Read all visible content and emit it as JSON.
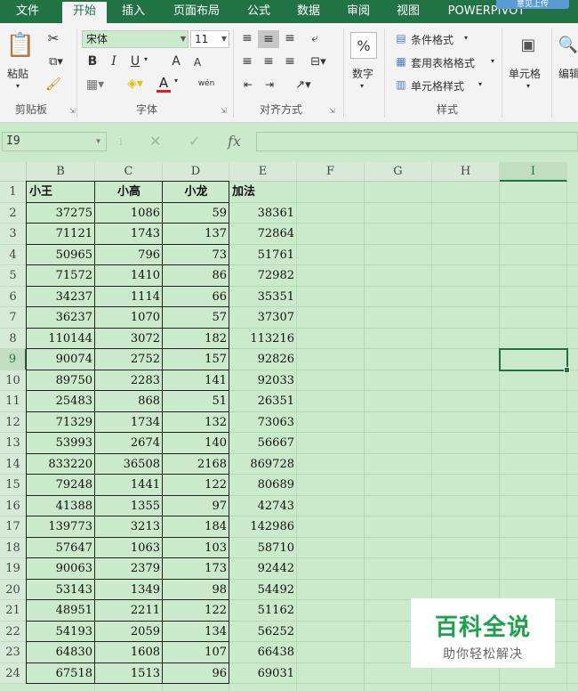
{
  "ribbon": {
    "tabs": [
      "文件",
      "开始",
      "插入",
      "页面布局",
      "公式",
      "数据",
      "审阅",
      "视图",
      "POWERPIVOT"
    ],
    "active_tab": "开始",
    "hint_badge": "意见上传",
    "clipboard": {
      "paste": "粘贴",
      "group": "剪贴板"
    },
    "font": {
      "name": "宋体",
      "size": "11",
      "group": "字体",
      "bold": "B",
      "italic": "I",
      "underline": "U",
      "grow": "A",
      "shrink": "A",
      "font_color": "A",
      "phonetic": "wén"
    },
    "alignment": {
      "group": "对齐方式"
    },
    "number": {
      "label": "数字",
      "percent": "%"
    },
    "styles": {
      "group": "样式",
      "conditional": "条件格式",
      "table": "套用表格格式",
      "cell_styles": "单元格样式"
    },
    "cells": {
      "label": "单元格"
    },
    "editing": {
      "label": "编辑"
    }
  },
  "formula_bar": {
    "name_box": "I9",
    "fx": "fx",
    "cancel": "✕",
    "enter": "✓",
    "content": ""
  },
  "columns": [
    "B",
    "C",
    "D",
    "E",
    "F",
    "G",
    "H",
    "I"
  ],
  "selected_column": "I",
  "selected_row": "9",
  "row_numbers": [
    "1",
    "2",
    "3",
    "4",
    "5",
    "6",
    "7",
    "8",
    "9",
    "10",
    "11",
    "12",
    "13",
    "14",
    "15",
    "16",
    "17",
    "18",
    "19",
    "20",
    "21",
    "22",
    "23",
    "24"
  ],
  "headers": {
    "b": "小王",
    "c": "小高",
    "d": "小龙",
    "e": "加法"
  },
  "rows": [
    [
      "37275",
      "1086",
      "59",
      "38361"
    ],
    [
      "71121",
      "1743",
      "137",
      "72864"
    ],
    [
      "50965",
      "796",
      "73",
      "51761"
    ],
    [
      "71572",
      "1410",
      "86",
      "72982"
    ],
    [
      "34237",
      "1114",
      "66",
      "35351"
    ],
    [
      "36237",
      "1070",
      "57",
      "37307"
    ],
    [
      "110144",
      "3072",
      "182",
      "113216"
    ],
    [
      "90074",
      "2752",
      "157",
      "92826"
    ],
    [
      "89750",
      "2283",
      "141",
      "92033"
    ],
    [
      "25483",
      "868",
      "51",
      "26351"
    ],
    [
      "71329",
      "1734",
      "132",
      "73063"
    ],
    [
      "53993",
      "2674",
      "140",
      "56667"
    ],
    [
      "833220",
      "36508",
      "2168",
      "869728"
    ],
    [
      "79248",
      "1441",
      "122",
      "80689"
    ],
    [
      "41388",
      "1355",
      "97",
      "42743"
    ],
    [
      "139773",
      "3213",
      "184",
      "142986"
    ],
    [
      "57647",
      "1063",
      "103",
      "58710"
    ],
    [
      "90063",
      "2379",
      "173",
      "92442"
    ],
    [
      "53143",
      "1349",
      "98",
      "54492"
    ],
    [
      "48951",
      "2211",
      "122",
      "51162"
    ],
    [
      "54193",
      "2059",
      "134",
      "56252"
    ],
    [
      "64830",
      "1608",
      "107",
      "66438"
    ],
    [
      "67518",
      "1513",
      "96",
      "69031"
    ]
  ],
  "watermark": {
    "title": "百科全说",
    "subtitle": "助你轻松解决"
  },
  "colors": {
    "accent": "#217346",
    "sheet_bg": "#cbe9cb",
    "watermark": "#1aa34a"
  }
}
